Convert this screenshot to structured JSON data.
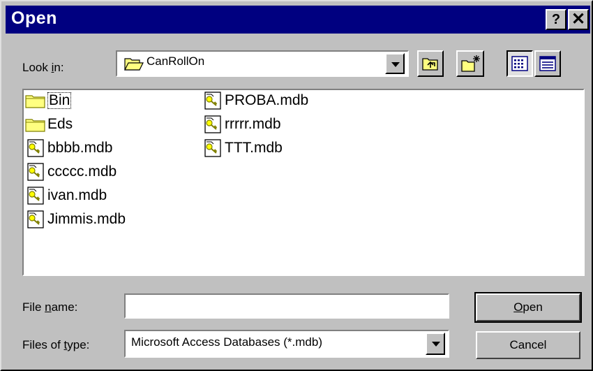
{
  "window": {
    "title": "Open",
    "help_label": "?",
    "close_label": "✕"
  },
  "look_in": {
    "label_pre": "Look ",
    "label_key": "i",
    "label_post": "n:",
    "value": "CanRollOn"
  },
  "toolbar": {
    "up_icon": "up-one-level-icon",
    "new_folder_icon": "new-folder-icon",
    "list_icon": "list-view-icon",
    "details_icon": "details-view-icon"
  },
  "files": [
    {
      "name": "Bin",
      "type": "folder"
    },
    {
      "name": "Eds",
      "type": "folder"
    },
    {
      "name": "bbbb.mdb",
      "type": "mdb"
    },
    {
      "name": "ccccc.mdb",
      "type": "mdb"
    },
    {
      "name": "ivan.mdb",
      "type": "mdb"
    },
    {
      "name": "Jimmis.mdb",
      "type": "mdb"
    },
    {
      "name": "PROBA.mdb",
      "type": "mdb"
    },
    {
      "name": "rrrrr.mdb",
      "type": "mdb"
    },
    {
      "name": "TTT.mdb",
      "type": "mdb"
    }
  ],
  "file_name": {
    "label_pre": "File ",
    "label_key": "n",
    "label_post": "ame:",
    "value": ""
  },
  "file_type": {
    "label_pre": "Files of ",
    "label_key": "t",
    "label_post": "ype:",
    "value": "Microsoft Access Databases (*.mdb)"
  },
  "buttons": {
    "open_key": "O",
    "open_rest": "pen",
    "cancel": "Cancel"
  },
  "colors": {
    "titlebar": "#000080",
    "face": "#c0c0c0",
    "folder": "#ffff80"
  }
}
